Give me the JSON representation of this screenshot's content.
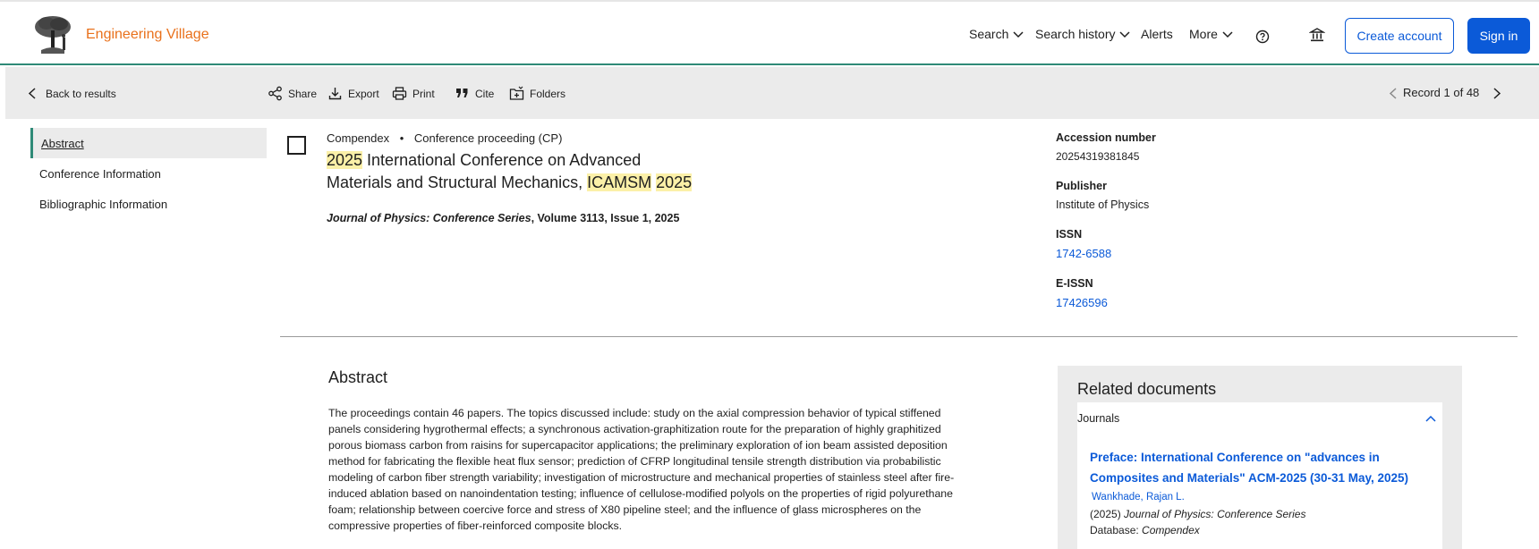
{
  "header": {
    "brand": "Engineering Village",
    "nav": [
      {
        "label": "Search"
      },
      {
        "label": "Search history"
      },
      {
        "label": "Alerts"
      },
      {
        "label": "More"
      }
    ],
    "create_account": "Create account",
    "sign_in": "Sign in",
    "accent_color": "#0b5ad8",
    "brand_color": "#e9711c"
  },
  "toolbar": {
    "back": "Back to results",
    "actions": [
      "Share",
      "Export",
      "Print",
      "Cite",
      "Folders"
    ],
    "record_label": "Record 1 of 48"
  },
  "sidebar": {
    "items": [
      "Abstract",
      "Conference Information",
      "Bibliographic Information"
    ]
  },
  "record": {
    "database": "Compendex",
    "doc_type": "Conference proceeding (CP)",
    "title_parts": [
      "2025",
      " International Conference on Advanced",
      "Materials and Structural Mechanics, ",
      "ICAMSM",
      " ",
      "2025"
    ],
    "source_journal": "Journal of Physics: Conference Series",
    "source_rest": ", Volume 3113, Issue 1, 2025"
  },
  "details": {
    "accession_label": "Accession number",
    "accession_value": "20254319381845",
    "publisher_label": "Publisher",
    "publisher_value": "Institute of Physics",
    "issn_label": "ISSN",
    "issn_value": "1742-6588",
    "eissn_label": "E-ISSN",
    "eissn_value": "17426596"
  },
  "abstract": {
    "heading": "Abstract",
    "lines": [
      "The proceedings contain 46 papers. The topics discussed include: study on the axial compression behavior of typical stiffened",
      "panels considering hygrothermal effects; a synchronous activation-graphitization route for the preparation of highly graphitized",
      "porous biomass carbon from raisins for supercapacitor applications; the preliminary exploration of ion beam assisted deposition",
      "method for fabricating the flexible heat flux sensor; prediction of CFRP longitudinal tensile strength distribution via probabilistic",
      "modeling of carbon fiber strength variability; investigation of microstructure and mechanical properties of stainless steel after fire-",
      "induced ablation based on nanoindentation testing; influence of cellulose-modified polyols on the properties of rigid polyurethane",
      "foam; relationship between coercive force and stress of X80 pipeline steel; and the influence of glass microspheres on the",
      "compressive properties of fiber-reinforced composite blocks."
    ]
  },
  "related": {
    "title": "Related documents",
    "section": "Journals",
    "doc_title_line1": "Preface: International Conference on \"advances in",
    "doc_title_line2": "Composites and Materials\" ACM-2025 (30-31 May, 2025)",
    "author": "Wankhade, Rajan L.",
    "year": "(2025) ",
    "journal": "Journal of Physics: Conference Series",
    "database_label": "Database: ",
    "database_value": "Compendex"
  }
}
